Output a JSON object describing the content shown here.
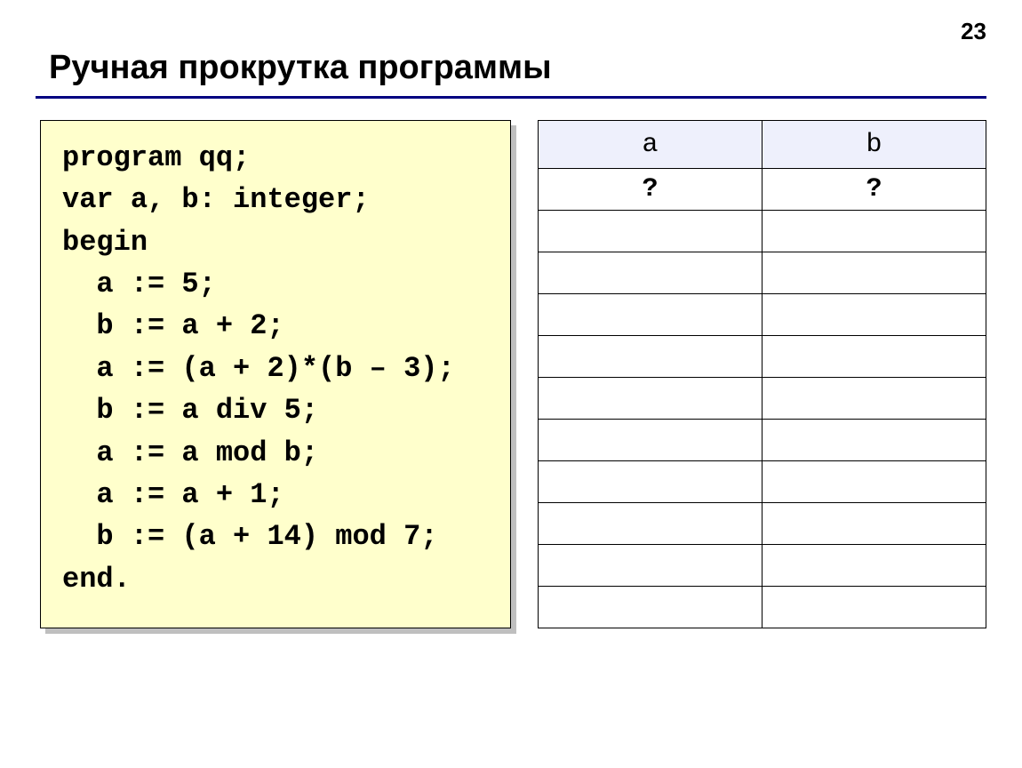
{
  "page_number": "23",
  "title": "Ручная прокрутка программы",
  "code": {
    "l1": "program qq;",
    "l2": "var a, b: integer;",
    "l3": "begin",
    "l4": "  a := 5;",
    "l5": "  b := a + 2;",
    "l6": "  a := (a + 2)*(b – 3);",
    "l7": "  b := a div 5;",
    "l8": "  a := a mod b;",
    "l9": "  a := a + 1;",
    "l10": "  b := (a + 14) mod 7;",
    "l11": "end."
  },
  "table": {
    "header_a": "a",
    "header_b": "b",
    "row1": {
      "a": "?",
      "b": "?"
    },
    "row2": {
      "a": "",
      "b": ""
    },
    "row3": {
      "a": "",
      "b": ""
    },
    "row4": {
      "a": "",
      "b": ""
    },
    "row5": {
      "a": "",
      "b": ""
    },
    "row6": {
      "a": "",
      "b": ""
    },
    "row7": {
      "a": "",
      "b": ""
    },
    "row8": {
      "a": "",
      "b": ""
    },
    "row9": {
      "a": "",
      "b": ""
    },
    "row10": {
      "a": "",
      "b": ""
    },
    "row11": {
      "a": "",
      "b": ""
    }
  }
}
